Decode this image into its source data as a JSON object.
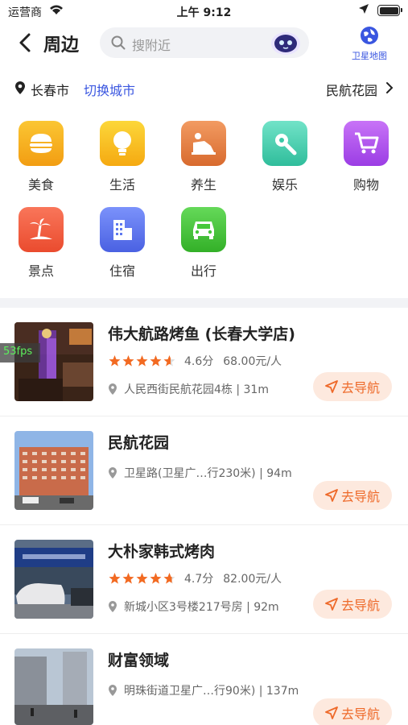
{
  "status": {
    "carrier": "运营商",
    "time": "上午 9:12"
  },
  "header": {
    "title": "周边",
    "search_placeholder": "搜附近",
    "satellite_label": "卫星地图"
  },
  "location": {
    "city": "长春市",
    "switch_label": "切换城市",
    "place": "民航花园"
  },
  "categories": [
    {
      "label": "美食",
      "icon": "burger-icon",
      "color": "#f7b21c"
    },
    {
      "label": "生活",
      "icon": "lightbulb-icon",
      "color": "#f7c21c"
    },
    {
      "label": "养生",
      "icon": "massage-icon",
      "color": "#ec8a4c"
    },
    {
      "label": "娱乐",
      "icon": "mic-icon",
      "color": "#4fd5b5"
    },
    {
      "label": "购物",
      "icon": "cart-icon",
      "color": "#b454ef"
    },
    {
      "label": "景点",
      "icon": "palm-icon",
      "color": "#f4603e"
    },
    {
      "label": "住宿",
      "icon": "building-icon",
      "color": "#5e78f0"
    },
    {
      "label": "出行",
      "icon": "car-icon",
      "color": "#46c83a"
    }
  ],
  "places": [
    {
      "name": "伟大航路烤鱼 (长春大学店)",
      "rating": 4.6,
      "rating_text": "4.6分",
      "price": "68.00元/人",
      "address": "人民西街民航花园4栋 | 31m",
      "nav_label": "去导航"
    },
    {
      "name": "民航花园",
      "address": "卫星路(卫星广…行230米) | 94m",
      "nav_label": "去导航"
    },
    {
      "name": "大朴家韩式烤肉",
      "rating": 4.7,
      "rating_text": "4.7分",
      "price": "82.00元/人",
      "address": "新城小区3号楼217号房 | 92m",
      "nav_label": "去导航"
    },
    {
      "name": "财富领域",
      "address": "明珠街道卫星广…行90米) | 137m",
      "nav_label": "去导航"
    }
  ],
  "fps": "53fps"
}
